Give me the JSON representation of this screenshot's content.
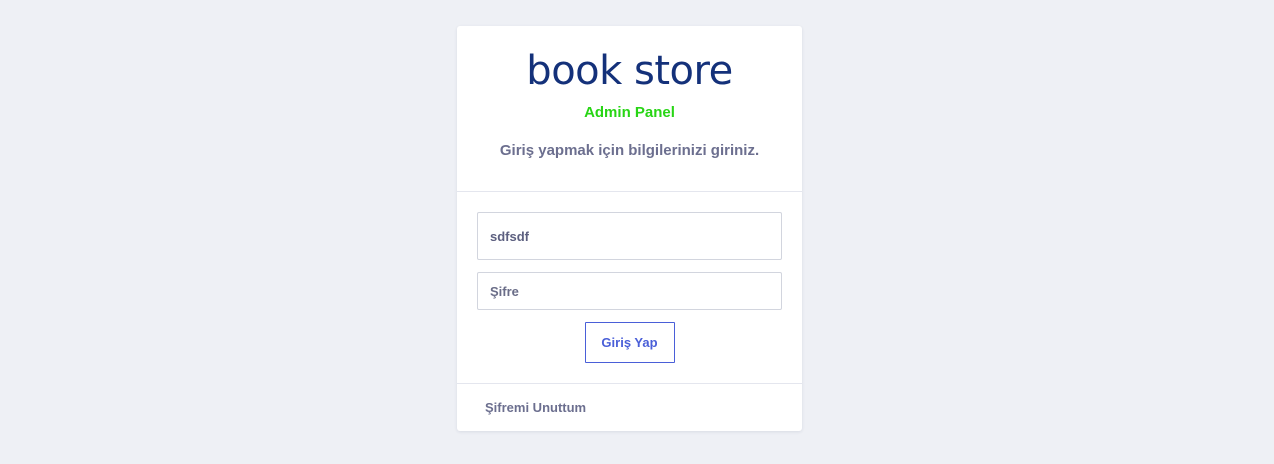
{
  "brand": {
    "logo_text": "book store",
    "subtitle": "Admin Panel",
    "instruction": "Giriş yapmak için bilgilerinizi giriniz."
  },
  "form": {
    "username_value": "sdfsdf",
    "password_placeholder": "Şifre",
    "submit_label": "Giriş Yap"
  },
  "footer": {
    "forgot_password_label": "Şifremi Unuttum"
  },
  "colors": {
    "background": "#eef0f5",
    "logo": "#14317a",
    "subtitle_green": "#28d515",
    "muted_text": "#6c6f8f",
    "button_accent": "#4a5fd8"
  }
}
